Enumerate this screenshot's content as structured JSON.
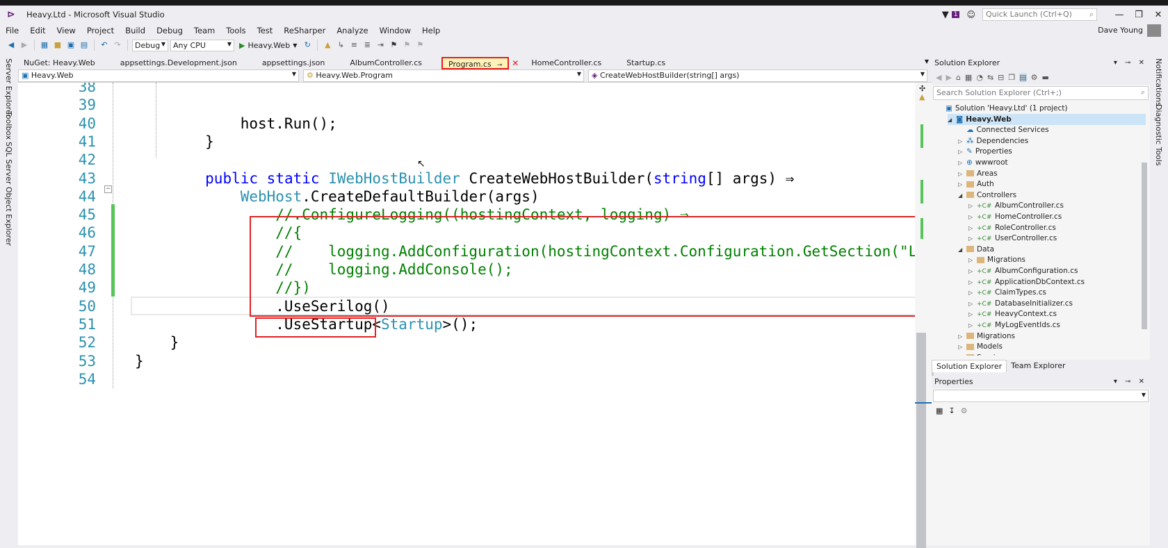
{
  "window": {
    "title": "Heavy.Ltd - Microsoft Visual Studio",
    "notification_count": "1",
    "quick_launch_placeholder": "Quick Launch (Ctrl+Q)",
    "user": "Dave Young"
  },
  "menu": [
    "File",
    "Edit",
    "View",
    "Project",
    "Build",
    "Debug",
    "Team",
    "Tools",
    "Test",
    "ReSharper",
    "Analyze",
    "Window",
    "Help"
  ],
  "toolbar": {
    "configuration": "Debug",
    "platform": "Any CPU",
    "run_target": "Heavy.Web"
  },
  "left_rail": [
    "Server Explorer",
    "Toolbox",
    "SQL Server Object Explorer"
  ],
  "right_rail": [
    "Notifications",
    "Diagnostic Tools"
  ],
  "tabs": [
    {
      "label": "NuGet: Heavy.Web",
      "active": false
    },
    {
      "label": "appsettings.Development.json",
      "active": false
    },
    {
      "label": "appsettings.json",
      "active": false
    },
    {
      "label": "AlbumController.cs",
      "active": false
    },
    {
      "label": "Program.cs",
      "active": true
    },
    {
      "label": "HomeController.cs",
      "active": false
    },
    {
      "label": "Startup.cs",
      "active": false
    }
  ],
  "navbar": {
    "project": "Heavy.Web",
    "type": "Heavy.Web.Program",
    "member": "CreateWebHostBuilder(string[] args)"
  },
  "code": [
    {
      "n": "38",
      "tokens": []
    },
    {
      "n": "39",
      "tokens": []
    },
    {
      "n": "40",
      "tokens": [
        {
          "t": "            host.Run();",
          "c": "pl"
        }
      ]
    },
    {
      "n": "41",
      "tokens": [
        {
          "t": "        }",
          "c": "pl"
        }
      ]
    },
    {
      "n": "42",
      "tokens": []
    },
    {
      "n": "43",
      "tokens": [
        {
          "t": "        ",
          "c": "pl"
        },
        {
          "t": "public",
          "c": "kw"
        },
        {
          "t": " ",
          "c": "pl"
        },
        {
          "t": "static",
          "c": "kw"
        },
        {
          "t": " ",
          "c": "pl"
        },
        {
          "t": "IWebHostBuilder",
          "c": "ty"
        },
        {
          "t": " CreateWebHostBuilder(",
          "c": "pl"
        },
        {
          "t": "string",
          "c": "kw"
        },
        {
          "t": "[] args) ⇒",
          "c": "pl"
        }
      ]
    },
    {
      "n": "44",
      "tokens": [
        {
          "t": "            ",
          "c": "pl"
        },
        {
          "t": "WebHost",
          "c": "ty"
        },
        {
          "t": ".CreateDefaultBuilder(args)",
          "c": "pl"
        }
      ]
    },
    {
      "n": "45",
      "tokens": [
        {
          "t": "                //.ConfigureLogging((hostingContext, logging) ⇒",
          "c": "cm"
        }
      ]
    },
    {
      "n": "46",
      "tokens": [
        {
          "t": "                //{",
          "c": "cm"
        }
      ]
    },
    {
      "n": "47",
      "tokens": [
        {
          "t": "                //    logging.AddConfiguration(hostingContext.Configuration.GetSection(\"L",
          "c": "cm"
        }
      ]
    },
    {
      "n": "48",
      "tokens": [
        {
          "t": "                //    logging.AddConsole();",
          "c": "cm"
        }
      ]
    },
    {
      "n": "49",
      "tokens": [
        {
          "t": "                //})",
          "c": "cm"
        }
      ]
    },
    {
      "n": "50",
      "tokens": [
        {
          "t": "                .UseSerilog()",
          "c": "pl"
        }
      ]
    },
    {
      "n": "51",
      "tokens": [
        {
          "t": "                .UseStartup<",
          "c": "pl"
        },
        {
          "t": "Startup",
          "c": "ty"
        },
        {
          "t": ">();",
          "c": "pl"
        }
      ]
    },
    {
      "n": "52",
      "tokens": [
        {
          "t": "    }",
          "c": "pl"
        }
      ]
    },
    {
      "n": "53",
      "tokens": [
        {
          "t": "}",
          "c": "pl"
        }
      ]
    },
    {
      "n": "54",
      "tokens": []
    }
  ],
  "solution_explorer": {
    "title": "Solution Explorer",
    "search_placeholder": "Search Solution Explorer (Ctrl+;)",
    "nodes": [
      {
        "label": "Solution 'Heavy.Ltd' (1 project)",
        "icon": "solution-icon",
        "level": 0,
        "exp": ""
      },
      {
        "label": "Heavy.Web",
        "icon": "web-project-icon",
        "level": 1,
        "exp": "◢",
        "selected": true
      },
      {
        "label": "Connected Services",
        "icon": "cloud-icon",
        "level": 2,
        "exp": ""
      },
      {
        "label": "Dependencies",
        "icon": "dependencies-icon",
        "level": 2,
        "exp": "▷"
      },
      {
        "label": "Properties",
        "icon": "wrench-icon",
        "level": 2,
        "exp": "▷"
      },
      {
        "label": "wwwroot",
        "icon": "globe-icon",
        "level": 2,
        "exp": "▷"
      },
      {
        "label": "Areas",
        "icon": "folder-icon",
        "level": 2,
        "exp": "▷"
      },
      {
        "label": "Auth",
        "icon": "folder-icon",
        "level": 2,
        "exp": "▷"
      },
      {
        "label": "Controllers",
        "icon": "folder-icon",
        "level": 2,
        "exp": "◢"
      },
      {
        "label": "AlbumController.cs",
        "icon": "csharp-file-icon",
        "level": 3,
        "exp": "▷"
      },
      {
        "label": "HomeController.cs",
        "icon": "csharp-file-icon",
        "level": 3,
        "exp": "▷"
      },
      {
        "label": "RoleController.cs",
        "icon": "csharp-file-icon",
        "level": 3,
        "exp": "▷"
      },
      {
        "label": "UserController.cs",
        "icon": "csharp-file-icon",
        "level": 3,
        "exp": "▷"
      },
      {
        "label": "Data",
        "icon": "folder-icon",
        "level": 2,
        "exp": "◢"
      },
      {
        "label": "Migrations",
        "icon": "folder-icon",
        "level": 3,
        "exp": "▷"
      },
      {
        "label": "AlbumConfiguration.cs",
        "icon": "csharp-file-icon",
        "level": 3,
        "exp": "▷"
      },
      {
        "label": "ApplicationDbContext.cs",
        "icon": "csharp-file-icon",
        "level": 3,
        "exp": "▷"
      },
      {
        "label": "ClaimTypes.cs",
        "icon": "csharp-file-icon",
        "level": 3,
        "exp": "▷"
      },
      {
        "label": "DatabaseInitializer.cs",
        "icon": "csharp-file-icon",
        "level": 3,
        "exp": "▷"
      },
      {
        "label": "HeavyContext.cs",
        "icon": "csharp-file-icon",
        "level": 3,
        "exp": "▷"
      },
      {
        "label": "MyLogEventIds.cs",
        "icon": "csharp-file-icon",
        "level": 3,
        "exp": "▷"
      },
      {
        "label": "Migrations",
        "icon": "folder-icon",
        "level": 2,
        "exp": "▷"
      },
      {
        "label": "Models",
        "icon": "folder-icon",
        "level": 2,
        "exp": "▷"
      },
      {
        "label": "Services",
        "icon": "folder-icon",
        "level": 2,
        "exp": "▷"
      }
    ],
    "bottom_tabs": [
      {
        "label": "Solution Explorer",
        "active": true
      },
      {
        "label": "Team Explorer",
        "active": false
      }
    ]
  },
  "properties": {
    "title": "Properties"
  },
  "colors": {
    "highlight_box": "#e02020",
    "keyword": "#0000ff",
    "type": "#2b91af",
    "comment": "#008000",
    "change_bar": "#57c45a"
  }
}
